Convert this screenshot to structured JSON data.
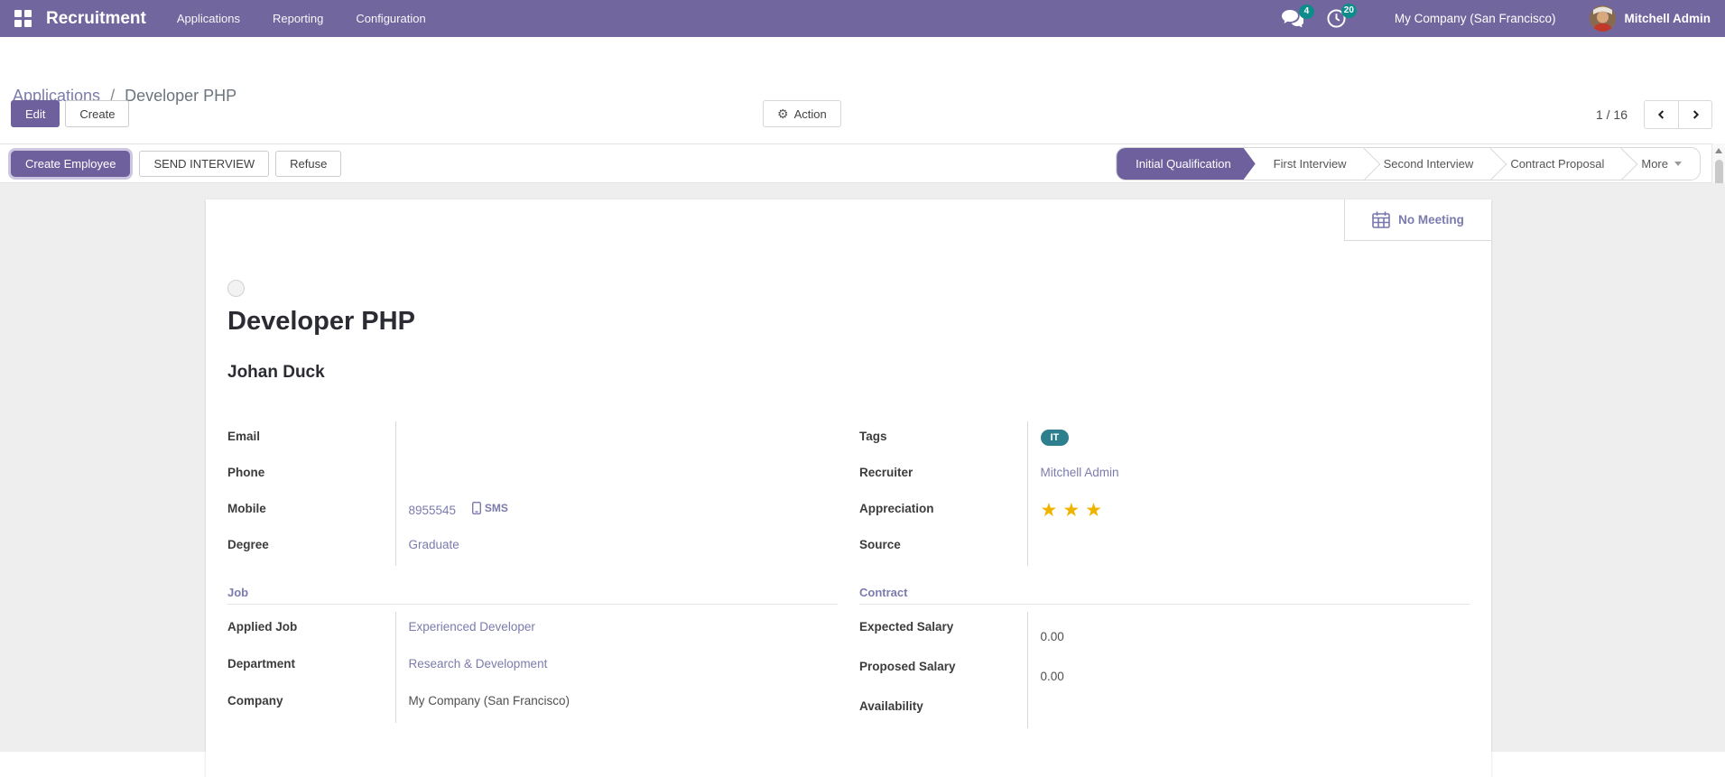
{
  "navbar": {
    "app_name": "Recruitment",
    "menus": [
      "Applications",
      "Reporting",
      "Configuration"
    ],
    "messages_badge": "4",
    "activities_badge": "20",
    "company_name": "My Company (San Francisco)",
    "user_name": "Mitchell Admin"
  },
  "breadcrumb": {
    "parent": "Applications",
    "separator": "/",
    "current": "Developer PHP"
  },
  "control_panel": {
    "edit_label": "Edit",
    "create_label": "Create",
    "action_label": "Action",
    "pager_text": "1 / 16"
  },
  "statusbar": {
    "create_employee_label": "Create Employee",
    "send_interview_label": "SEND INTERVIEW",
    "refuse_label": "Refuse",
    "stages": [
      {
        "label": "Initial Qualification",
        "active": true
      },
      {
        "label": "First Interview",
        "active": false
      },
      {
        "label": "Second Interview",
        "active": false
      },
      {
        "label": "Contract Proposal",
        "active": false
      }
    ],
    "more_label": "More"
  },
  "form": {
    "meeting_label": "No Meeting",
    "position_title": "Developer PHP",
    "applicant_name": "Johan Duck",
    "fields": {
      "email": {
        "label": "Email",
        "value": ""
      },
      "phone": {
        "label": "Phone",
        "value": ""
      },
      "mobile": {
        "label": "Mobile",
        "value": "8955545",
        "sms_label": "SMS"
      },
      "degree": {
        "label": "Degree",
        "value": "Graduate"
      },
      "tags": {
        "label": "Tags",
        "tag": "IT"
      },
      "recruiter": {
        "label": "Recruiter",
        "value": "Mitchell Admin"
      },
      "appreciation": {
        "label": "Appreciation",
        "stars": "★★★",
        "count": 3
      },
      "source": {
        "label": "Source",
        "value": ""
      }
    },
    "job_section": {
      "title": "Job",
      "applied_job": {
        "label": "Applied Job",
        "value": "Experienced Developer"
      },
      "department": {
        "label": "Department",
        "value": "Research & Development"
      },
      "company": {
        "label": "Company",
        "value": "My Company (San Francisco)"
      }
    },
    "contract_section": {
      "title": "Contract",
      "expected_salary": {
        "label": "Expected Salary",
        "value": "0.00"
      },
      "proposed_salary": {
        "label": "Proposed Salary",
        "value": "0.00"
      },
      "availability": {
        "label": "Availability",
        "value": ""
      }
    }
  },
  "colors": {
    "navbar_bg": "#71669e",
    "primary": "#6e609c",
    "link": "#7c7bad",
    "badge_teal": "#0e8c8c",
    "tag_teal": "#2d7f8d",
    "star_gold": "#f0b400"
  }
}
